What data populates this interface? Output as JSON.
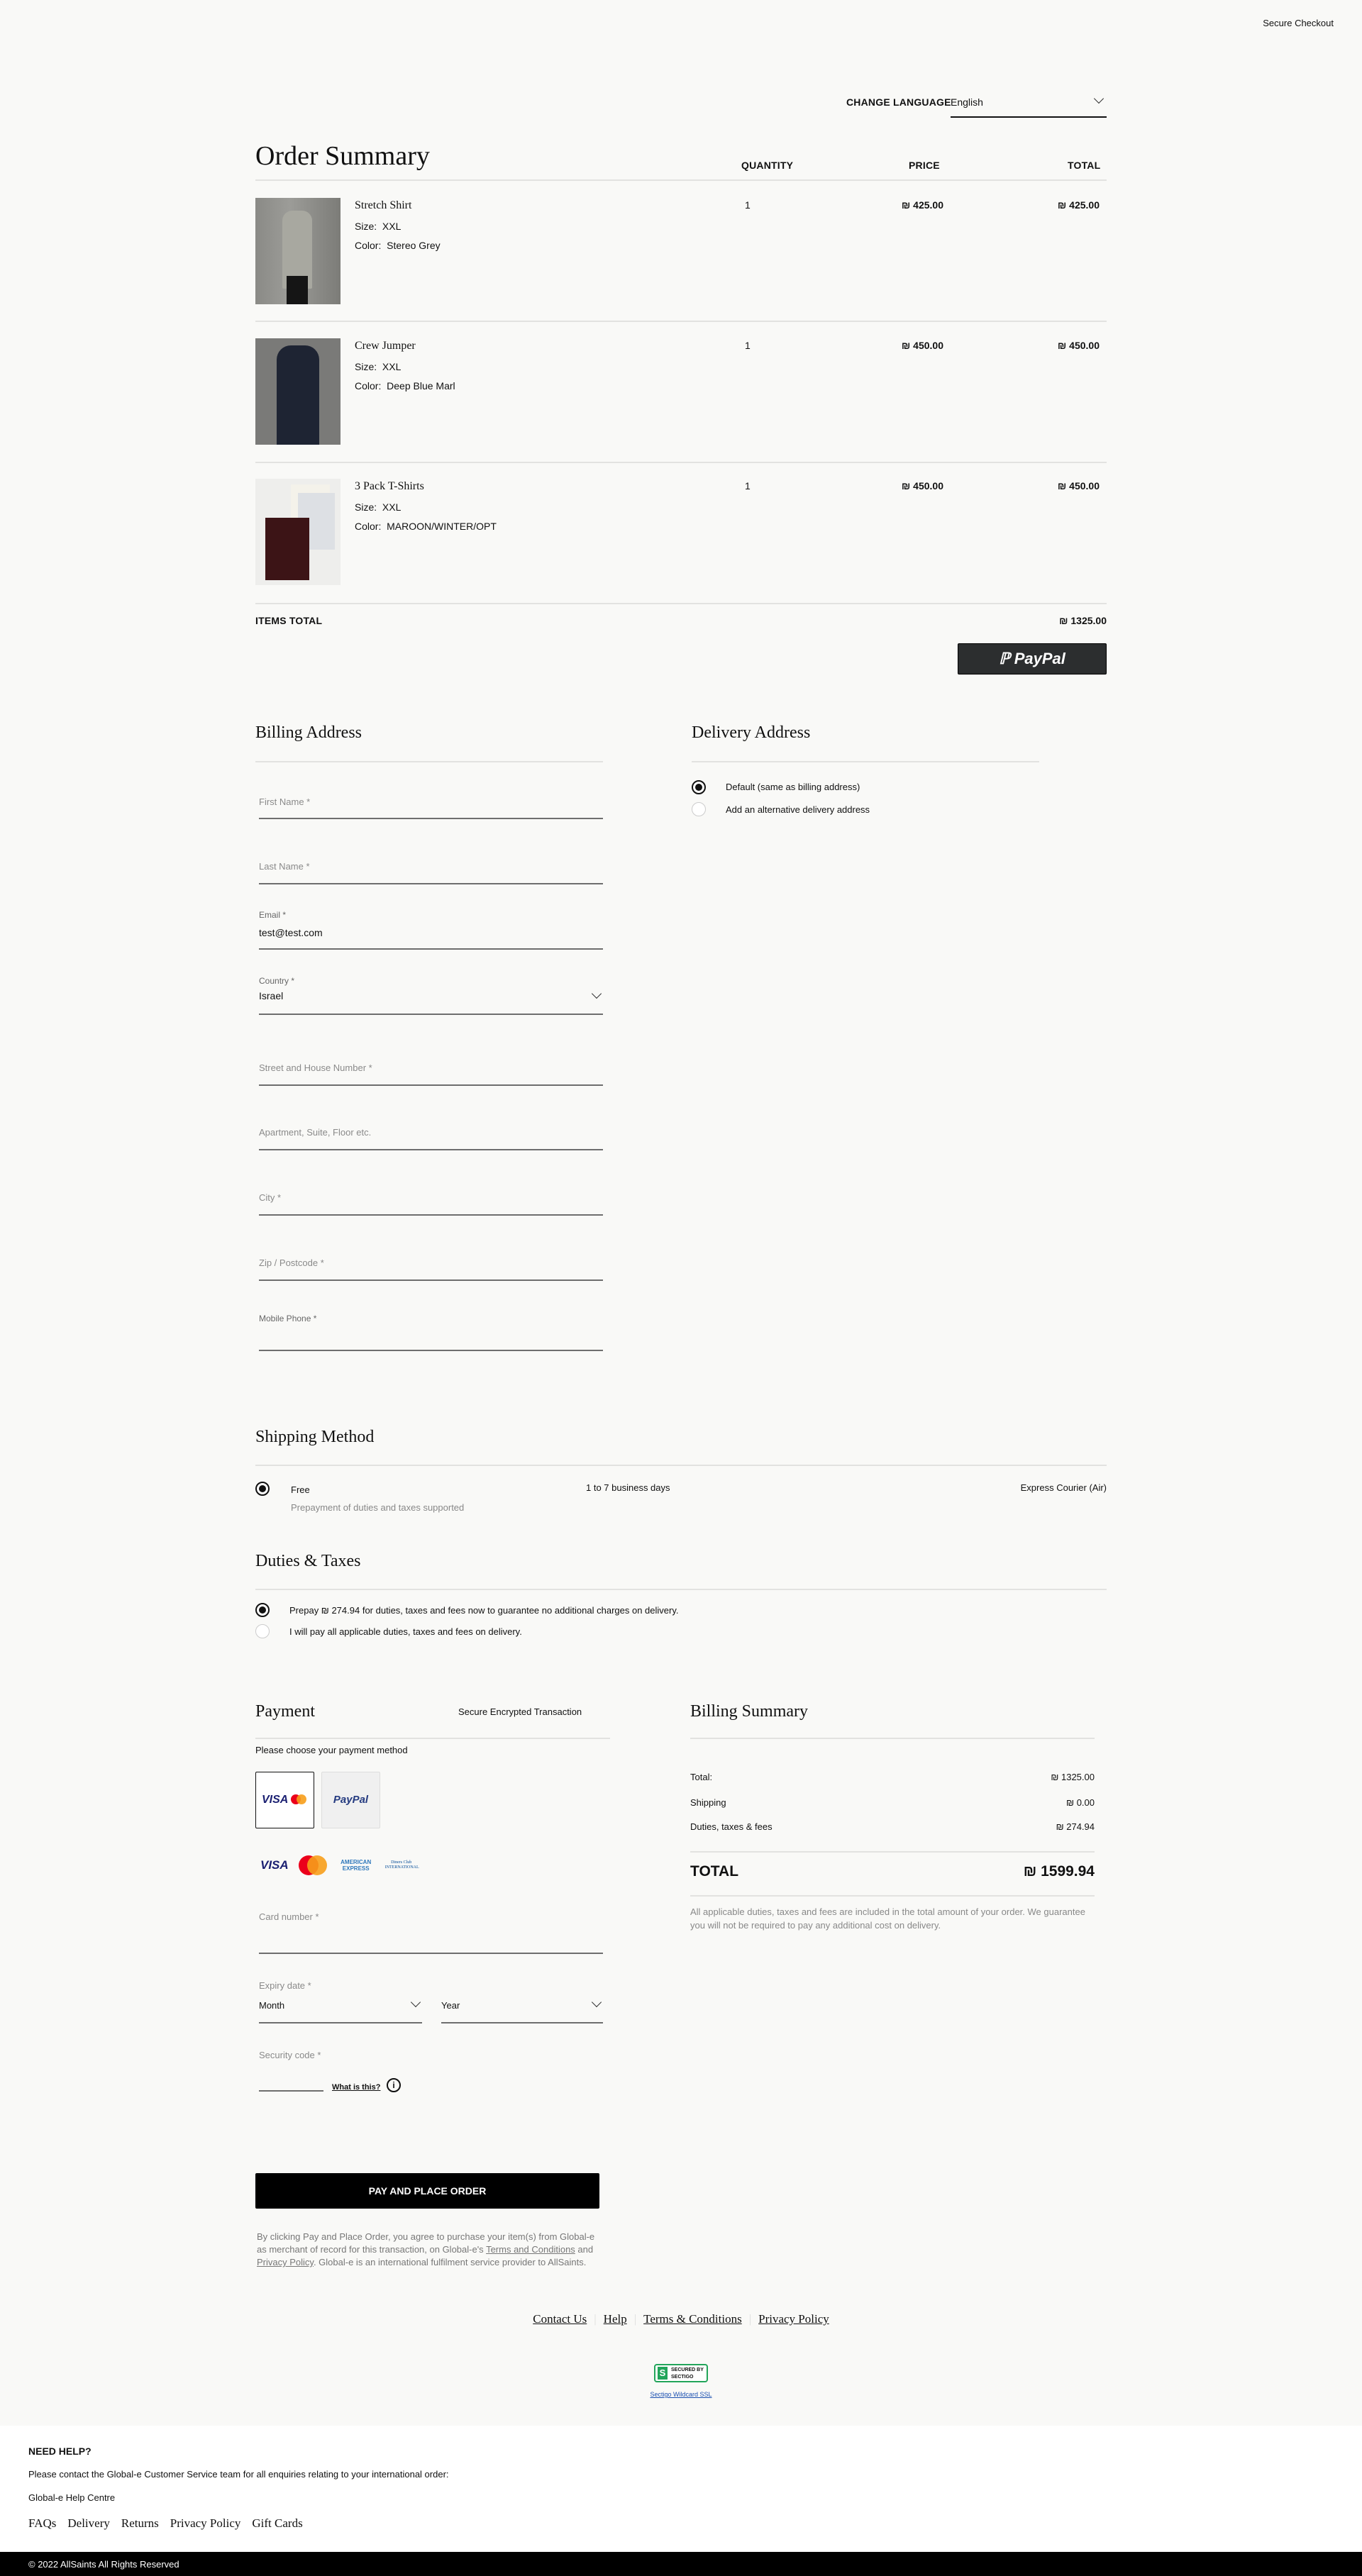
{
  "header": {
    "secure_checkout": "Secure Checkout",
    "change_language_label": "CHANGE LANGUAGE",
    "language_value": "English"
  },
  "order": {
    "title": "Order Summary",
    "col_quantity": "QUANTITY",
    "col_price": "PRICE",
    "col_total": "TOTAL",
    "items": [
      {
        "name": "Stretch Shirt",
        "size_label": "Size:",
        "size": "XXL",
        "color_label": "Color:",
        "color": "Stereo Grey",
        "quantity": "1",
        "price": "₪ 425.00",
        "total": "₪ 425.00"
      },
      {
        "name": "Crew Jumper",
        "size_label": "Size:",
        "size": "XXL",
        "color_label": "Color:",
        "color": "Deep Blue Marl",
        "quantity": "1",
        "price": "₪ 450.00",
        "total": "₪ 450.00"
      },
      {
        "name": "3 Pack T-Shirts",
        "size_label": "Size:",
        "size": "XXL",
        "color_label": "Color:",
        "color": "MAROON/WINTER/OPT",
        "quantity": "1",
        "price": "₪ 450.00",
        "total": "₪ 450.00"
      }
    ],
    "items_total_label": "ITEMS TOTAL",
    "items_total": "₪ 1325.00",
    "paypal_label": "PayPal"
  },
  "billing": {
    "title": "Billing Address",
    "first_name": "First Name *",
    "last_name": "Last Name *",
    "email_label": "Email *",
    "email_value": "test@test.com",
    "country_label": "Country *",
    "country_value": "Israel",
    "street": "Street and House Number *",
    "apartment": "Apartment, Suite, Floor etc.",
    "city": "City *",
    "zip": "Zip / Postcode *",
    "mobile": "Mobile Phone *"
  },
  "delivery": {
    "title": "Delivery Address",
    "options": [
      "Default (same as billing address)",
      "Add an alternative delivery address"
    ]
  },
  "shipping": {
    "title": "Shipping Method",
    "option": "Free",
    "note": "Prepayment of duties and taxes supported",
    "time": "1 to 7 business days",
    "carrier": "Express Courier (Air)"
  },
  "duties": {
    "title": "Duties & Taxes",
    "options": [
      "Prepay ₪ 274.94 for duties, taxes and fees now to guarantee no additional charges on delivery.",
      "I will pay all applicable duties, taxes and fees on delivery."
    ]
  },
  "payment": {
    "title": "Payment",
    "secure": "Secure Encrypted Transaction",
    "choose": "Please choose your payment method",
    "card_method": "VISA",
    "paypal_method": "PayPal",
    "logos": {
      "visa": "VISA",
      "amex": "AMERICAN EXPRESS",
      "diners": "Diners Club INTERNATIONAL"
    },
    "card_number": "Card number *",
    "expiry": "Expiry date *",
    "month": "Month",
    "year": "Year",
    "security": "Security code *",
    "what_is_this": "What is this?",
    "pay_button": "PAY AND PLACE ORDER",
    "legal_1": "By clicking Pay and Place Order, you agree to purchase your item(s) from Global-e as merchant of record for this transaction, on Global-e's ",
    "legal_terms": "Terms and Conditions",
    "legal_and": " and ",
    "legal_privacy": "Privacy Policy",
    "legal_2": ". Global-e is an international fulfilment service provider to AllSaints."
  },
  "summary": {
    "title": "Billing Summary",
    "rows": [
      {
        "label": "Total:",
        "value": "₪ 1325.00"
      },
      {
        "label": "Shipping",
        "value": "₪ 0.00"
      },
      {
        "label": "Duties, taxes & fees",
        "value": "₪ 274.94"
      }
    ],
    "total_label": "TOTAL",
    "total_value": "₪ 1599.94",
    "note": "All applicable duties, taxes and fees are included in the total amount of your order. We guarantee you will not be required to pay any additional cost on delivery."
  },
  "links": [
    "Contact Us",
    "Help",
    "Terms & Conditions",
    "Privacy Policy"
  ],
  "sectigo": {
    "badge": "SECURED BY SECTIGO",
    "link": "Sectigo Wildcard SSL"
  },
  "footer": {
    "need_help": "NEED HELP?",
    "contact_text": "Please contact the Global-e Customer Service team for all enquiries relating to your international order:",
    "help_centre": "Global-e Help Centre",
    "links": [
      "FAQs",
      "Delivery",
      "Returns",
      "Privacy Policy",
      "Gift Cards"
    ],
    "copyright": "© 2022 AllSaints All Rights Reserved"
  },
  "colors": {
    "background": "#f9f9f7",
    "button": "#000000",
    "paypal_button": "#2c2e2f",
    "sectigo_green": "#22a55a"
  }
}
